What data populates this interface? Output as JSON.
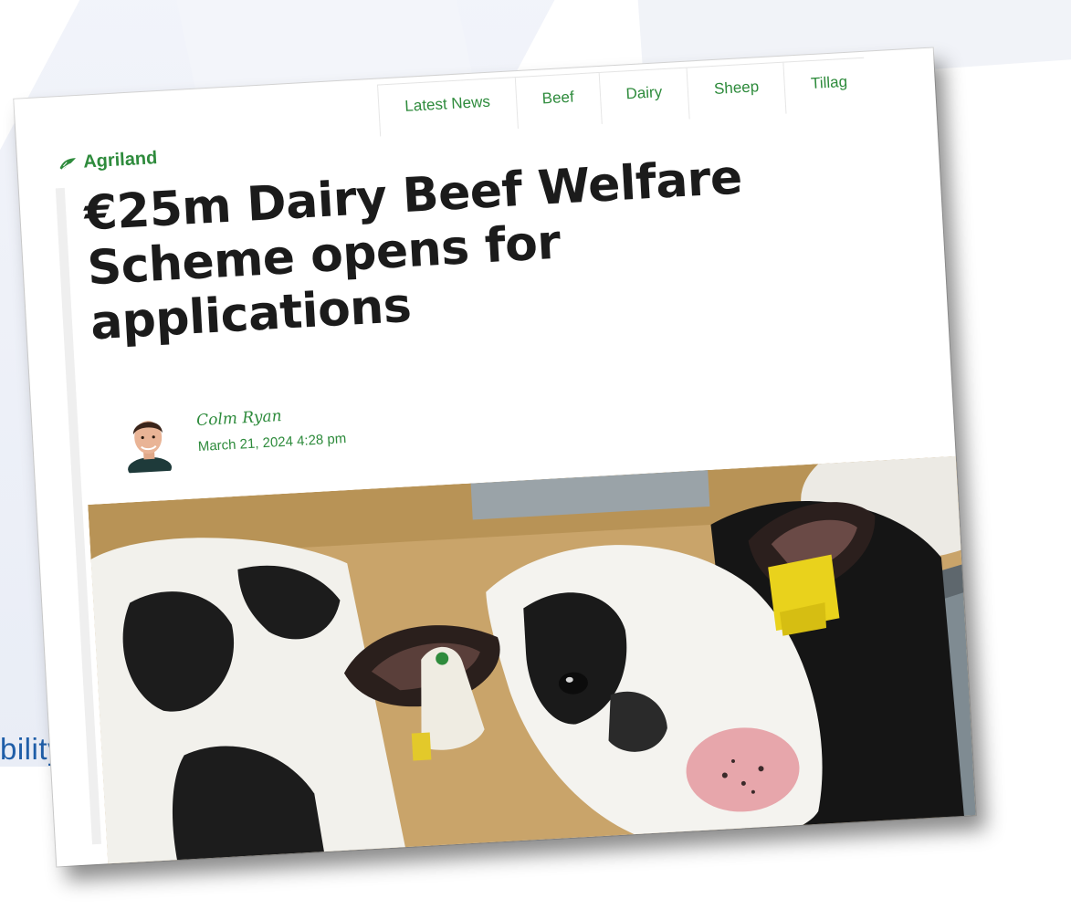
{
  "slide": {
    "text_fragment": "bility"
  },
  "site": {
    "logo_text": "Agriland",
    "brand_color": "#2e8b3c"
  },
  "nav": {
    "tabs": [
      {
        "label": "Latest News"
      },
      {
        "label": "Beef"
      },
      {
        "label": "Dairy"
      },
      {
        "label": "Sheep"
      },
      {
        "label": "Tillag"
      }
    ]
  },
  "article": {
    "headline": "€25m Dairy Beef Welfare Scheme opens for applications",
    "author": "Colm Ryan",
    "date": "March 21, 2024 4:28 pm",
    "hero_image": "calf-with-ear-tags-photo"
  },
  "colors": {
    "headline": "#1b1b1b",
    "slide_text": "#1f5ea8"
  }
}
